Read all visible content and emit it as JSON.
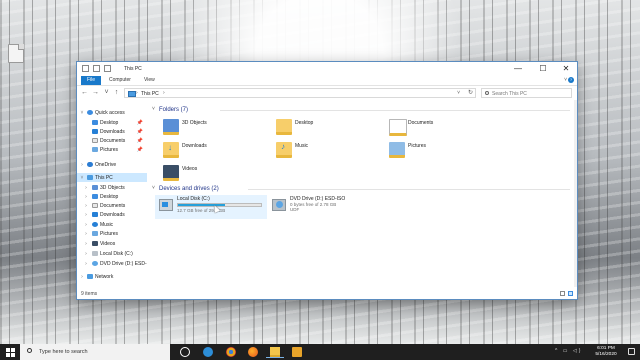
{
  "window": {
    "title": "This PC",
    "minimize": "—",
    "maximize": "☐",
    "close": "✕"
  },
  "ribbon": {
    "tabs": [
      "File",
      "Computer",
      "View"
    ],
    "toggle": "˅",
    "help": "?"
  },
  "navbar": {
    "back": "←",
    "forward": "→",
    "recent": "˅",
    "up": "↑",
    "breadcrumb": [
      "This PC"
    ],
    "sep": "›",
    "dropdown": "˅",
    "refresh": "↻",
    "search_placeholder": "Search This PC"
  },
  "navpane": {
    "quick_access": "Quick access",
    "quick_items": [
      "Desktop",
      "Downloads",
      "Documents",
      "Pictures"
    ],
    "onedrive": "OneDrive",
    "this_pc": "This PC",
    "pc_items": [
      "3D Objects",
      "Desktop",
      "Documents",
      "Downloads",
      "Music",
      "Pictures",
      "Videos",
      "Local Disk (C:)",
      "DVD Drive (D:) ESD-"
    ],
    "network": "Network",
    "pin": "📌"
  },
  "content": {
    "folders_header": "Folders (7)",
    "folders": [
      {
        "label": "3D Objects",
        "icon": "3d-objects-folder-icon"
      },
      {
        "label": "Desktop",
        "icon": "desktop-folder-icon"
      },
      {
        "label": "Documents",
        "icon": "documents-folder-icon"
      },
      {
        "label": "Downloads",
        "icon": "downloads-folder-icon"
      },
      {
        "label": "Music",
        "icon": "music-folder-icon"
      },
      {
        "label": "Pictures",
        "icon": "pictures-folder-icon"
      },
      {
        "label": "Videos",
        "icon": "videos-folder-icon"
      }
    ],
    "devices_header": "Devices and drives (2)",
    "drives": [
      {
        "name": "Local Disk (C:)",
        "free": "12.7 GB free of 29.4 GB",
        "used_fraction": 0.57,
        "fs": ""
      },
      {
        "name": "DVD Drive (D:) ESD-ISO",
        "free": "0 bytes free of 2.78 GB",
        "used_fraction": 1.0,
        "fs": "UDF"
      }
    ]
  },
  "statusbar": {
    "items": "9 items"
  },
  "taskbar": {
    "search_placeholder": "Type here to search",
    "time": "6:01 PM",
    "date": "5/16/2020",
    "tray": "^ ▭ ◁)"
  },
  "colors": {
    "accent": "#1979ca",
    "selection": "#cce8ff",
    "drive_fill": "#26a0da",
    "taskbar": "#1f1f1f"
  }
}
